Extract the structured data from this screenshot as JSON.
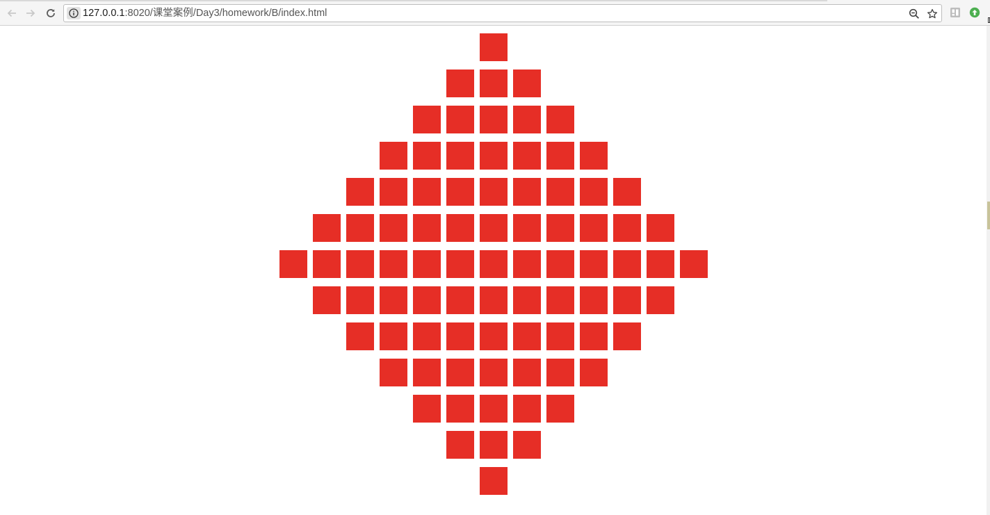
{
  "browser": {
    "url_host": "127.0.0.1",
    "url_path": ":8020/课堂案例/Day3/homework/B/index.html",
    "icons": {
      "back": "arrow-left-icon",
      "forward": "arrow-right-icon",
      "reload": "reload-icon",
      "site_info": "info-icon",
      "zoom": "zoom-out-icon",
      "bookmark": "star-icon",
      "extension_1": "extension-icon",
      "extension_2": "upload-arrow-icon"
    }
  },
  "page": {
    "square_color": "#e62e26",
    "rows": [
      1,
      3,
      5,
      7,
      9,
      11,
      13,
      11,
      9,
      7,
      5,
      3,
      1
    ]
  }
}
